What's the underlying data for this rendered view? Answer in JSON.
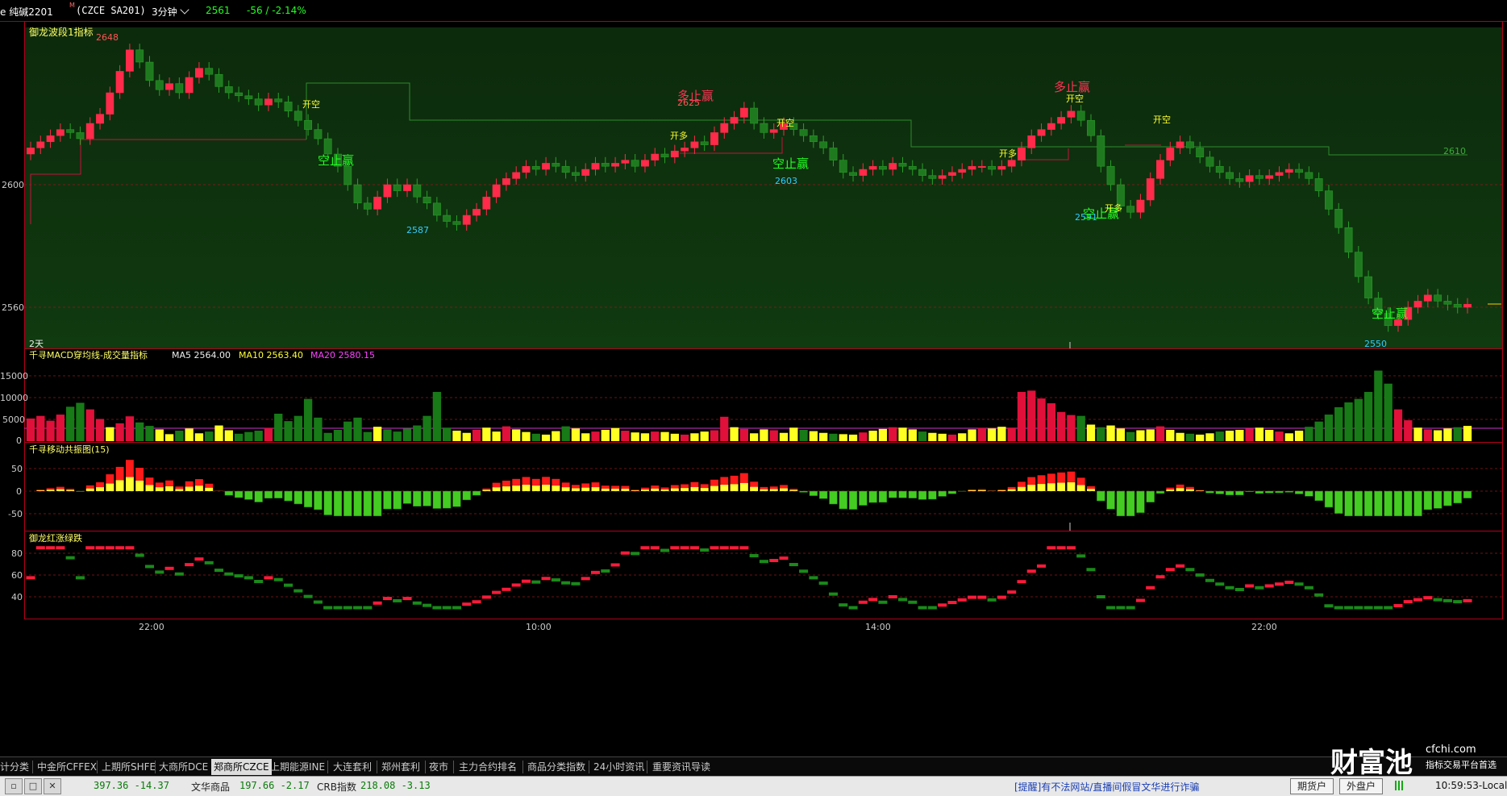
{
  "header": {
    "symbol_name": "e 纯碱2201",
    "symbol_mark": "M",
    "symbol_code": "(CZCE SA201)",
    "period": "3分钟",
    "price": "2561",
    "change": "-56 / -2.14%"
  },
  "colors": {
    "up": "#ff2a4a",
    "down": "#1f7a1f",
    "accent_green": "#22ff22",
    "yellow": "#ffff33",
    "cyan": "#33ccff",
    "frame": "#b3001b"
  },
  "panels": {
    "main": {
      "indicator_label": "御龙波段1指标",
      "y_ticks": [
        "2600",
        "2560"
      ],
      "y_tick_values": [
        2600,
        2560
      ],
      "period_note": "2天",
      "right_level_label": "2610",
      "price_labels": [
        {
          "text": "2648",
          "color": "#ff5555"
        },
        {
          "text": "2587",
          "color": "#33ccff"
        },
        {
          "text": "2625",
          "color": "#ff5555"
        },
        {
          "text": "2603",
          "color": "#33ccff"
        },
        {
          "text": "2591",
          "color": "#33ccff"
        },
        {
          "text": "2550",
          "color": "#33ccff"
        }
      ],
      "signals": [
        {
          "text": "开空",
          "color": "#ffff33"
        },
        {
          "text": "空止赢",
          "color": "#22ff22"
        },
        {
          "text": "多止赢",
          "color": "#ff3355"
        },
        {
          "text": "开多",
          "color": "#ffff33"
        },
        {
          "text": "开空",
          "color": "#ffff33"
        },
        {
          "text": "空止赢",
          "color": "#22ff22"
        },
        {
          "text": "开多",
          "color": "#ffff33"
        },
        {
          "text": "多止赢",
          "color": "#ff3355"
        },
        {
          "text": "开空",
          "color": "#ffff33"
        },
        {
          "text": "开空",
          "color": "#ffff33"
        },
        {
          "text": "空止赢",
          "color": "#22ff22"
        },
        {
          "text": "开多",
          "color": "#ffff33"
        },
        {
          "text": "空止赢",
          "color": "#22ff22"
        }
      ]
    },
    "volume": {
      "indicator_label": "千寻MACD穿均线-成交量指标",
      "ma5": "MA5 2564.00",
      "ma10": "MA10 2563.40",
      "ma20": "MA20 2580.15",
      "y_ticks": [
        "15000",
        "10000",
        "5000",
        "0"
      ],
      "y_tick_values": [
        15000,
        10000,
        5000,
        0
      ]
    },
    "osc": {
      "indicator_label": "千寻移动共振图(15)",
      "y_ticks": [
        "50",
        "0",
        "-50"
      ],
      "y_tick_values": [
        50,
        0,
        -50
      ]
    },
    "trend": {
      "indicator_label": "御龙红涨绿跌",
      "y_ticks": [
        "80",
        "60",
        "40"
      ],
      "y_tick_values": [
        80,
        60,
        40
      ]
    },
    "x_axis": [
      "22:00",
      "10:00",
      "14:00",
      "22:00"
    ]
  },
  "bottom_tabs": [
    "计分类",
    "中金所CFFEX",
    "上期所SHFE",
    "大商所DCE",
    "郑商所CZCE",
    "上期能源INE",
    "大连套利",
    "郑州套利",
    "夜市",
    "主力合约排名",
    "商品分类指数",
    "24小时资讯",
    "重要资讯导读"
  ],
  "active_tab_index": 4,
  "logo": {
    "name": "财富池",
    "url": "cfchi.com",
    "tagline": "指标交易平台首选"
  },
  "status": {
    "index1": "397.36 -14.37",
    "index2_name": "文华商品",
    "index2_value": "197.66 -2.17",
    "index3_name": "CRB指数",
    "index3_value": "218.08 -3.13",
    "notice": "[提醒]有不法网站/直播间假冒文华进行诈骗",
    "btn_futures": "期货户",
    "btn_foreign": "外盘户",
    "clock": "10:59:53-Local"
  },
  "series": {
    "main_close": [
      2612,
      2614,
      2616,
      2618,
      2617,
      2615,
      2620,
      2623,
      2630,
      2637,
      2644,
      2640,
      2634,
      2631,
      2633,
      2630,
      2635,
      2638,
      2636,
      2632,
      2630,
      2629,
      2628,
      2626,
      2628,
      2627,
      2624,
      2621,
      2618,
      2615,
      2610,
      2606,
      2600,
      2594,
      2592,
      2596,
      2600,
      2598,
      2600,
      2596,
      2594,
      2590,
      2588,
      2587,
      2590,
      2592,
      2596,
      2600,
      2602,
      2604,
      2606,
      2605,
      2607,
      2606,
      2604,
      2603,
      2605,
      2607,
      2606,
      2607,
      2608,
      2606,
      2608,
      2610,
      2609,
      2611,
      2612,
      2614,
      2613,
      2617,
      2620,
      2622,
      2625,
      2620,
      2617,
      2618,
      2620,
      2618,
      2616,
      2614,
      2612,
      2608,
      2604,
      2603,
      2605,
      2606,
      2605,
      2607,
      2606,
      2605,
      2603,
      2602,
      2603,
      2604,
      2605,
      2606,
      2606,
      2605,
      2606,
      2608,
      2612,
      2616,
      2618,
      2620,
      2622,
      2624,
      2621,
      2616,
      2606,
      2600,
      2593,
      2591,
      2595,
      2602,
      2608,
      2612,
      2614,
      2612,
      2609,
      2606,
      2604,
      2602,
      2601,
      2603,
      2602,
      2603,
      2604,
      2605,
      2604,
      2602,
      2598,
      2592,
      2586,
      2578,
      2570,
      2563,
      2558,
      2554,
      2556,
      2560,
      2562,
      2564,
      2562,
      2561,
      2560,
      2561
    ],
    "volume": [
      5200,
      5800,
      4700,
      6100,
      7900,
      8800,
      7300,
      5100,
      3200,
      4100,
      5700,
      4300,
      3500,
      2700,
      1600,
      2400,
      2900,
      1800,
      2200,
      3600,
      2500,
      1700,
      2100,
      2400,
      3000,
      6300,
      4600,
      5800,
      9700,
      5400,
      1900,
      2600,
      4500,
      5400,
      2100,
      3300,
      2700,
      2200,
      2900,
      3600,
      5800,
      11300,
      3100,
      2400,
      1900,
      2600,
      3100,
      2200,
      3400,
      2700,
      2100,
      1700,
      1500,
      2300,
      3400,
      2900,
      1800,
      2200,
      2600,
      3000,
      2400,
      2000,
      1800,
      2200,
      2100,
      1700,
      1500,
      1800,
      2200,
      2500,
      5600,
      3200,
      2800,
      1800,
      2700,
      2500,
      1900,
      3100,
      2600,
      2300,
      1900,
      1700,
      1600,
      1500,
      2000,
      2400,
      2800,
      3200,
      3100,
      2700,
      2200,
      1900,
      1700,
      1500,
      1800,
      2700,
      3000,
      2900,
      3300,
      3100,
      11300,
      11600,
      9800,
      8700,
      6700,
      6000,
      5800,
      3800,
      3200,
      3600,
      2900,
      2100,
      2500,
      2700,
      3400,
      2600,
      1900,
      1700,
      1500,
      1800,
      2200,
      2400,
      2600,
      2900,
      3100,
      2600,
      2200,
      1800,
      2400,
      3300,
      4500,
      6100,
      7800,
      8900,
      9700,
      11300,
      16200,
      13200,
      7300,
      4800,
      3100,
      2700,
      2500,
      2900,
      3200,
      3500
    ]
  }
}
